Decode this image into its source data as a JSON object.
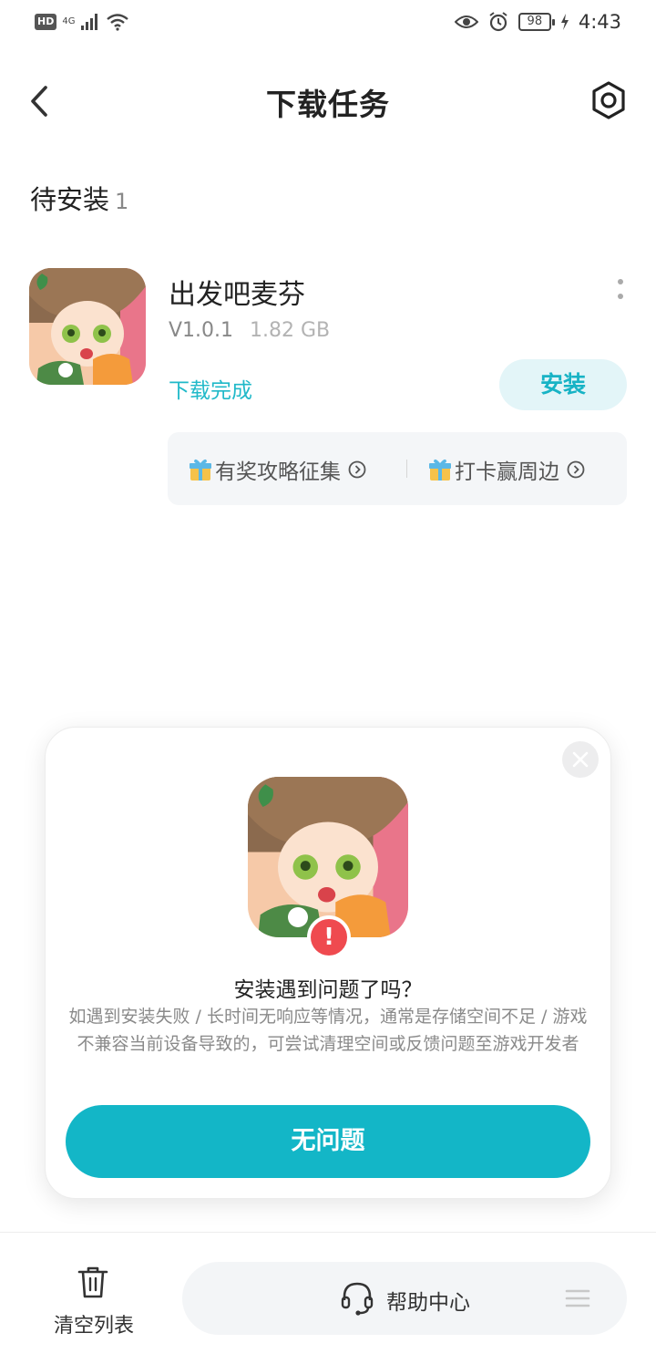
{
  "status_bar": {
    "hd": "HD",
    "network": "4G",
    "battery": "98",
    "time": "4:43"
  },
  "header": {
    "title": "下载任务",
    "back_icon": "chevron-left-icon",
    "settings_icon": "hexagon-gear-icon"
  },
  "section": {
    "title": "待安装",
    "count": "1"
  },
  "task": {
    "name": "出发吧麦芬",
    "version": "V1.0.1",
    "size": "1.82 GB",
    "status": "下载完成",
    "install_label": "安装",
    "promos": [
      {
        "label": "有奖攻略征集",
        "icon": "gift-icon"
      },
      {
        "label": "打卡赢周边",
        "icon": "gift-icon"
      }
    ]
  },
  "modal": {
    "title": "安装遇到问题了吗？",
    "description": "如遇到安装失败 / 长时间无响应等情况，通常是存储空间不足 / 游戏不兼容当前设备导致的，可尝试清理空间或反馈问题至游戏开发者",
    "button": "无问题",
    "badge": "!"
  },
  "bottom": {
    "clear_label": "清空列表",
    "help_label": "帮助中心"
  },
  "colors": {
    "accent": "#13b6c7",
    "status_text": "#20b9c9",
    "install_bg": "#e3f5f8",
    "error": "#ef4a4f"
  }
}
